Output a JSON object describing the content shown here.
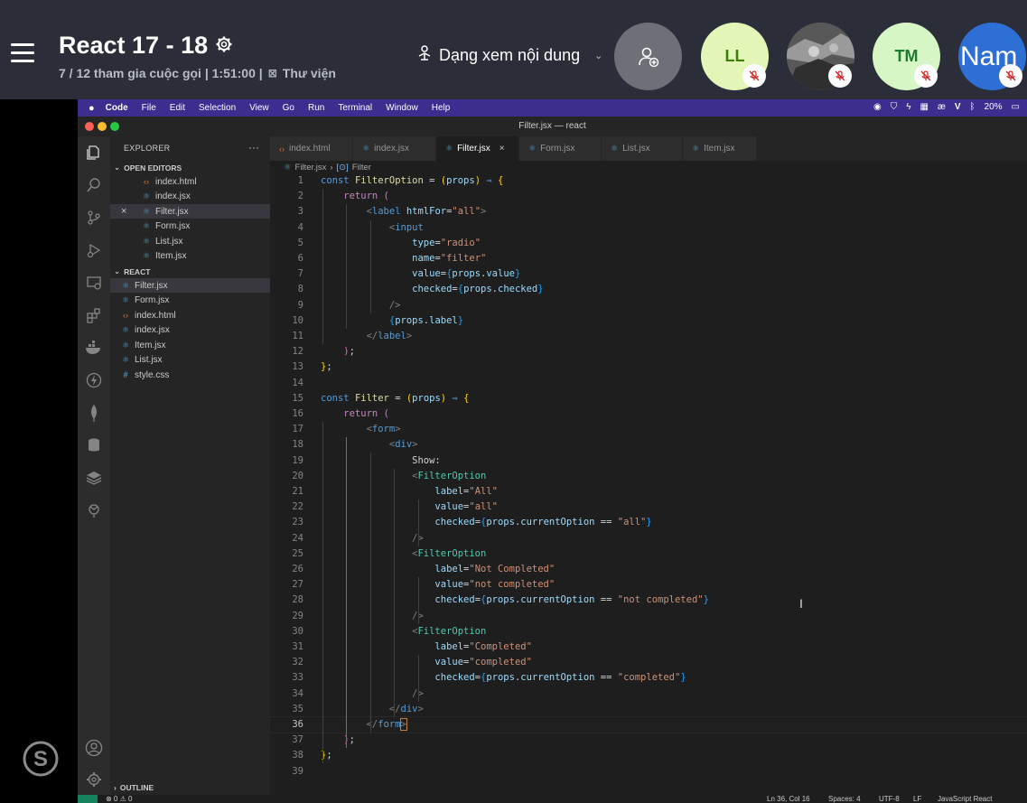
{
  "call": {
    "title": "React 17 - 18",
    "participants": "7 / 12 tham gia cuộc gọi | 1:51:00 |",
    "library": "Thư viện",
    "view_mode": "Dạng xem nội dung",
    "avatars": [
      {
        "initials": "LL",
        "bg": "#e3f6b8",
        "fg": "#3e7d0a"
      },
      {
        "initials": "",
        "bg": "#6b6b6b",
        "fg": "#ffffff"
      },
      {
        "initials": "TM",
        "bg": "#d6f6c6",
        "fg": "#1e7a2e"
      },
      {
        "initials": "Nam",
        "bg": "#2e6fd6",
        "fg": "#ffffff"
      }
    ]
  },
  "menubar": {
    "app": "Code",
    "items": [
      "File",
      "Edit",
      "Selection",
      "View",
      "Go",
      "Run",
      "Terminal",
      "Window",
      "Help"
    ],
    "battery": "20%"
  },
  "window": {
    "title": "Filter.jsx — react"
  },
  "explorer": {
    "header": "EXPLORER",
    "open_editors_label": "OPEN EDITORS",
    "open_editors": [
      {
        "name": "index.html",
        "type": "html"
      },
      {
        "name": "index.jsx",
        "type": "react"
      },
      {
        "name": "Filter.jsx",
        "type": "react",
        "active": true
      },
      {
        "name": "Form.jsx",
        "type": "react"
      },
      {
        "name": "List.jsx",
        "type": "react"
      },
      {
        "name": "Item.jsx",
        "type": "react"
      }
    ],
    "project_label": "REACT",
    "project_files": [
      {
        "name": "Filter.jsx",
        "type": "react",
        "active": true
      },
      {
        "name": "Form.jsx",
        "type": "react"
      },
      {
        "name": "index.html",
        "type": "html"
      },
      {
        "name": "index.jsx",
        "type": "react"
      },
      {
        "name": "Item.jsx",
        "type": "react"
      },
      {
        "name": "List.jsx",
        "type": "react"
      },
      {
        "name": "style.css",
        "type": "css"
      }
    ],
    "outline_label": "OUTLINE"
  },
  "tabs": [
    {
      "name": "index.html",
      "type": "html"
    },
    {
      "name": "index.jsx",
      "type": "react"
    },
    {
      "name": "Filter.jsx",
      "type": "react",
      "active": true
    },
    {
      "name": "Form.jsx",
      "type": "react"
    },
    {
      "name": "List.jsx",
      "type": "react"
    },
    {
      "name": "Item.jsx",
      "type": "react"
    }
  ],
  "breadcrumb": {
    "file": "Filter.jsx",
    "symbol": "Filter"
  },
  "editor": {
    "current_line": 36,
    "lines": [
      [
        [
          "const ",
          "kw"
        ],
        [
          "FilterOption",
          "fn"
        ],
        [
          " = ",
          "op"
        ],
        [
          "(",
          "br"
        ],
        [
          "props",
          "par"
        ],
        [
          ")",
          "br"
        ],
        [
          " ⇒ ",
          "kw"
        ],
        [
          "{",
          "br"
        ]
      ],
      [
        [
          "    return ",
          "ctrl"
        ],
        [
          "(",
          "br2"
        ]
      ],
      [
        [
          "        <",
          "punc"
        ],
        [
          "label",
          "tag"
        ],
        [
          " htmlFor",
          "attr"
        ],
        [
          "=",
          "op"
        ],
        [
          "\"all\"",
          "str"
        ],
        [
          ">",
          "punc"
        ]
      ],
      [
        [
          "            <",
          "punc"
        ],
        [
          "input",
          "tag"
        ]
      ],
      [
        [
          "                type",
          "attr"
        ],
        [
          "=",
          "op"
        ],
        [
          "\"radio\"",
          "str"
        ]
      ],
      [
        [
          "                name",
          "attr"
        ],
        [
          "=",
          "op"
        ],
        [
          "\"filter\"",
          "str"
        ]
      ],
      [
        [
          "                value",
          "attr"
        ],
        [
          "=",
          "op"
        ],
        [
          "{",
          "br3"
        ],
        [
          "props",
          "par"
        ],
        [
          ".",
          "op"
        ],
        [
          "value",
          "par"
        ],
        [
          "}",
          "br3"
        ]
      ],
      [
        [
          "                checked",
          "attr"
        ],
        [
          "=",
          "op"
        ],
        [
          "{",
          "br3"
        ],
        [
          "props",
          "par"
        ],
        [
          ".",
          "op"
        ],
        [
          "checked",
          "par"
        ],
        [
          "}",
          "br3"
        ]
      ],
      [
        [
          "            />",
          "punc"
        ]
      ],
      [
        [
          "            ",
          "txt"
        ],
        [
          "{",
          "br3"
        ],
        [
          "props",
          "par"
        ],
        [
          ".",
          "op"
        ],
        [
          "label",
          "par"
        ],
        [
          "}",
          "br3"
        ]
      ],
      [
        [
          "        </",
          "punc"
        ],
        [
          "label",
          "tag"
        ],
        [
          ">",
          "punc"
        ]
      ],
      [
        [
          "    ",
          "txt"
        ],
        [
          ")",
          "br2"
        ],
        [
          ";",
          "op"
        ]
      ],
      [
        [
          "}",
          "br"
        ],
        [
          ";",
          "op"
        ]
      ],
      [],
      [
        [
          "const ",
          "kw"
        ],
        [
          "Filter",
          "fn"
        ],
        [
          " = ",
          "op"
        ],
        [
          "(",
          "br"
        ],
        [
          "props",
          "par"
        ],
        [
          ")",
          "br"
        ],
        [
          " ⇒ ",
          "kw"
        ],
        [
          "{",
          "br"
        ]
      ],
      [
        [
          "    return ",
          "ctrl"
        ],
        [
          "(",
          "br2"
        ]
      ],
      [
        [
          "        <",
          "punc"
        ],
        [
          "form",
          "tag"
        ],
        [
          ">",
          "punc"
        ]
      ],
      [
        [
          "            <",
          "punc"
        ],
        [
          "div",
          "tag"
        ],
        [
          ">",
          "punc"
        ]
      ],
      [
        [
          "                Show:",
          "txt"
        ]
      ],
      [
        [
          "                <",
          "punc"
        ],
        [
          "FilterOption",
          "comp"
        ]
      ],
      [
        [
          "                    label",
          "attr"
        ],
        [
          "=",
          "op"
        ],
        [
          "\"All\"",
          "str"
        ]
      ],
      [
        [
          "                    value",
          "attr"
        ],
        [
          "=",
          "op"
        ],
        [
          "\"all\"",
          "str"
        ]
      ],
      [
        [
          "                    checked",
          "attr"
        ],
        [
          "=",
          "op"
        ],
        [
          "{",
          "br3"
        ],
        [
          "props",
          "par"
        ],
        [
          ".",
          "op"
        ],
        [
          "currentOption",
          "par"
        ],
        [
          " == ",
          "op"
        ],
        [
          "\"all\"",
          "str"
        ],
        [
          "}",
          "br3"
        ]
      ],
      [
        [
          "                />",
          "punc"
        ]
      ],
      [
        [
          "                <",
          "punc"
        ],
        [
          "FilterOption",
          "comp"
        ]
      ],
      [
        [
          "                    label",
          "attr"
        ],
        [
          "=",
          "op"
        ],
        [
          "\"Not Completed\"",
          "str"
        ]
      ],
      [
        [
          "                    value",
          "attr"
        ],
        [
          "=",
          "op"
        ],
        [
          "\"not completed\"",
          "str"
        ]
      ],
      [
        [
          "                    checked",
          "attr"
        ],
        [
          "=",
          "op"
        ],
        [
          "{",
          "br3"
        ],
        [
          "props",
          "par"
        ],
        [
          ".",
          "op"
        ],
        [
          "currentOption",
          "par"
        ],
        [
          " == ",
          "op"
        ],
        [
          "\"not completed\"",
          "str"
        ],
        [
          "}",
          "br3"
        ]
      ],
      [
        [
          "                />",
          "punc"
        ]
      ],
      [
        [
          "                <",
          "punc"
        ],
        [
          "FilterOption",
          "comp"
        ]
      ],
      [
        [
          "                    label",
          "attr"
        ],
        [
          "=",
          "op"
        ],
        [
          "\"Completed\"",
          "str"
        ]
      ],
      [
        [
          "                    value",
          "attr"
        ],
        [
          "=",
          "op"
        ],
        [
          "\"completed\"",
          "str"
        ]
      ],
      [
        [
          "                    checked",
          "attr"
        ],
        [
          "=",
          "op"
        ],
        [
          "{",
          "br3"
        ],
        [
          "props",
          "par"
        ],
        [
          ".",
          "op"
        ],
        [
          "currentOption",
          "par"
        ],
        [
          " == ",
          "op"
        ],
        [
          "\"completed\"",
          "str"
        ],
        [
          "}",
          "br3"
        ]
      ],
      [
        [
          "                />",
          "punc"
        ]
      ],
      [
        [
          "            </",
          "punc"
        ],
        [
          "div",
          "tag"
        ],
        [
          ">",
          "punc"
        ]
      ],
      [
        [
          "        </",
          "punc"
        ],
        [
          "form",
          "tag"
        ],
        [
          ">",
          "punc"
        ]
      ],
      [
        [
          "    ",
          "txt"
        ],
        [
          ")",
          "br2"
        ],
        [
          ";",
          "op"
        ]
      ],
      [
        [
          "}",
          "br"
        ],
        [
          ";",
          "op"
        ]
      ],
      []
    ]
  },
  "status": {
    "problems": "⊗ 0 ⚠ 0",
    "position": "Ln 36, Col 16",
    "spaces": "Spaces: 4",
    "encoding": "UTF-8",
    "eol": "LF",
    "language": "JavaScript React"
  },
  "colors": {
    "call_bg": "#2b2d38",
    "mac_menubar": "#3c2d8e",
    "editor_bg": "#1e1e1e",
    "sidebar_bg": "#252526"
  }
}
